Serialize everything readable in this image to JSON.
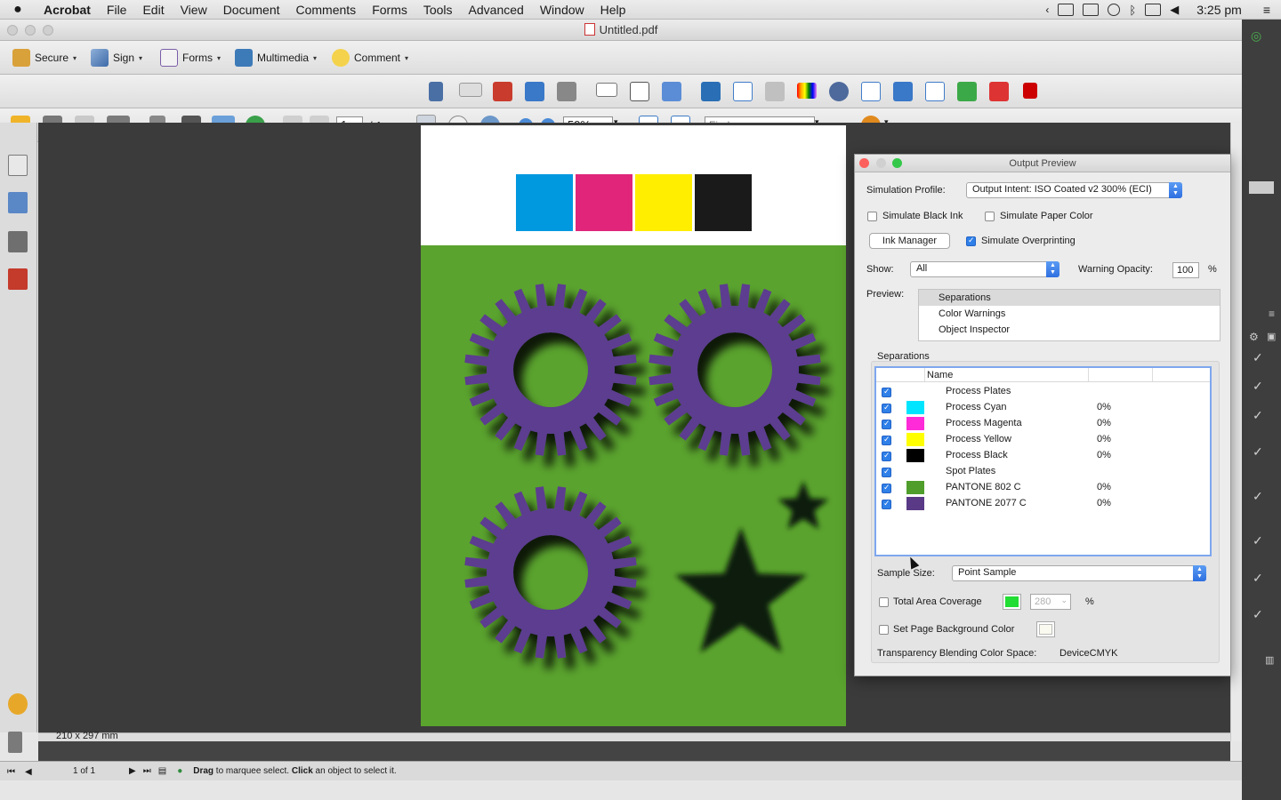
{
  "menubar": {
    "app": "Acrobat",
    "items": [
      "File",
      "Edit",
      "View",
      "Document",
      "Comments",
      "Forms",
      "Tools",
      "Advanced",
      "Window",
      "Help"
    ],
    "clock": "3:25 pm"
  },
  "window": {
    "title": "Untitled.pdf"
  },
  "toolbar1": {
    "secure": "Secure",
    "sign": "Sign",
    "forms": "Forms",
    "multimedia": "Multimedia",
    "comment": "Comment"
  },
  "toolbar3": {
    "page_current": "1",
    "page_total": "/ 1",
    "zoom": "59%",
    "find_placeholder": "Find"
  },
  "document": {
    "page_size": "210 x 297 mm",
    "colors": {
      "cyan": "#0099e0",
      "magenta": "#e0257a",
      "yellow": "#ffee00",
      "black": "#1a1a1a",
      "green": "#5aa32e",
      "purple": "#5c3d8f"
    }
  },
  "statusbar": {
    "page": "1 of 1",
    "msg_drag": "Drag",
    "msg_mid": " to marquee select. ",
    "msg_click": "Click",
    "msg_end": " an object to select it."
  },
  "dialog": {
    "title": "Output Preview",
    "simulation_profile_label": "Simulation Profile:",
    "simulation_profile_value": "Output Intent: ISO Coated v2 300% (ECI)",
    "simulate_black_ink": "Simulate Black Ink",
    "simulate_paper_color": "Simulate Paper Color",
    "ink_manager": "Ink Manager",
    "simulate_overprinting": "Simulate Overprinting",
    "show_label": "Show:",
    "show_value": "All",
    "warning_opacity_label": "Warning Opacity:",
    "warning_opacity_value": "100",
    "warning_opacity_unit": "%",
    "preview_label": "Preview:",
    "preview_items": [
      "Separations",
      "Color Warnings",
      "Object Inspector"
    ],
    "separations_label": "Separations",
    "sep_col_name": "Name",
    "separations": [
      {
        "name": "Process Plates",
        "color": "",
        "pct": ""
      },
      {
        "name": "Process Cyan",
        "color": "#00e5ff",
        "pct": "0%"
      },
      {
        "name": "Process Magenta",
        "color": "#ff2bd8",
        "pct": "0%"
      },
      {
        "name": "Process Yellow",
        "color": "#ffff00",
        "pct": "0%"
      },
      {
        "name": "Process Black",
        "color": "#000000",
        "pct": "0%"
      },
      {
        "name": "Spot Plates",
        "color": "",
        "pct": ""
      },
      {
        "name": "PANTONE 802 C",
        "color": "#4f9e2c",
        "pct": "0%"
      },
      {
        "name": "PANTONE 2077 C",
        "color": "#5a3a86",
        "pct": "0%"
      }
    ],
    "sample_size_label": "Sample Size:",
    "sample_size_value": "Point Sample",
    "total_area_coverage": "Total Area Coverage",
    "tac_value": "280",
    "tac_unit": "%",
    "set_page_bg": "Set Page Background Color",
    "blend_label": "Transparency Blending Color Space:",
    "blend_value": "DeviceCMYK"
  }
}
